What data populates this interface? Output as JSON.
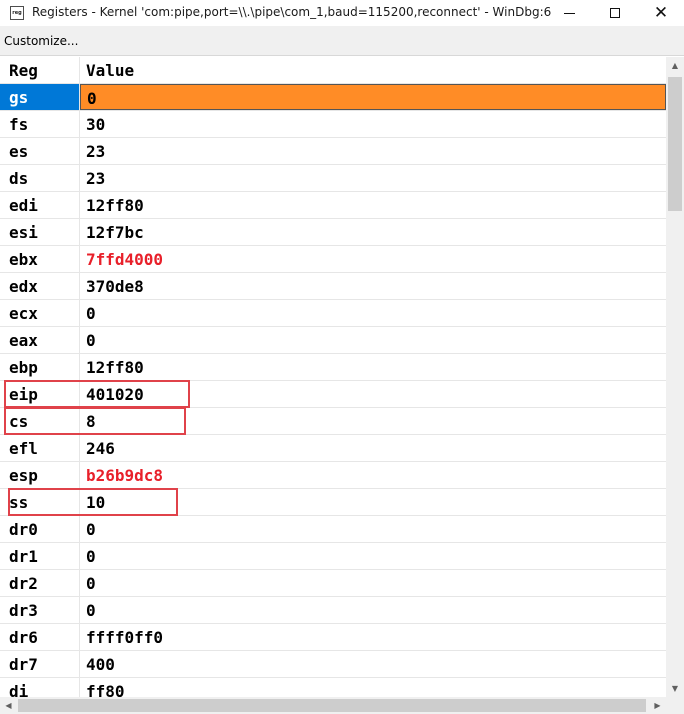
{
  "window": {
    "icon_label": "reg",
    "title": "Registers - Kernel 'com:pipe,port=\\\\.\\pipe\\com_1,baud=115200,reconnect' - WinDbg:6..."
  },
  "toolbar": {
    "customize_label": "Customize..."
  },
  "table": {
    "columns": [
      "Reg",
      "Value"
    ],
    "rows": [
      {
        "reg": "gs",
        "value": "0",
        "changed": false
      },
      {
        "reg": "fs",
        "value": "30",
        "changed": false
      },
      {
        "reg": "es",
        "value": "23",
        "changed": false
      },
      {
        "reg": "ds",
        "value": "23",
        "changed": false
      },
      {
        "reg": "edi",
        "value": "12ff80",
        "changed": false
      },
      {
        "reg": "esi",
        "value": "12f7bc",
        "changed": false
      },
      {
        "reg": "ebx",
        "value": "7ffd4000",
        "changed": true
      },
      {
        "reg": "edx",
        "value": "370de8",
        "changed": false
      },
      {
        "reg": "ecx",
        "value": "0",
        "changed": false
      },
      {
        "reg": "eax",
        "value": "0",
        "changed": false
      },
      {
        "reg": "ebp",
        "value": "12ff80",
        "changed": false
      },
      {
        "reg": "eip",
        "value": "401020",
        "changed": false
      },
      {
        "reg": "cs",
        "value": "8",
        "changed": false
      },
      {
        "reg": "efl",
        "value": "246",
        "changed": false
      },
      {
        "reg": "esp",
        "value": "b26b9dc8",
        "changed": true
      },
      {
        "reg": "ss",
        "value": "10",
        "changed": false
      },
      {
        "reg": "dr0",
        "value": "0",
        "changed": false
      },
      {
        "reg": "dr1",
        "value": "0",
        "changed": false
      },
      {
        "reg": "dr2",
        "value": "0",
        "changed": false
      },
      {
        "reg": "dr3",
        "value": "0",
        "changed": false
      },
      {
        "reg": "dr6",
        "value": "ffff0ff0",
        "changed": false
      },
      {
        "reg": "dr7",
        "value": "400",
        "changed": false
      },
      {
        "reg": "di",
        "value": "ff80",
        "changed": false
      }
    ],
    "selected_reg": "gs",
    "highlighted_regs": [
      "eip",
      "cs",
      "ss"
    ]
  },
  "colors": {
    "selection_name_bg": "#0078d7",
    "selection_value_bg": "#ff8c26",
    "changed_value": "#e8202a",
    "highlight_box": "#e0424a"
  }
}
